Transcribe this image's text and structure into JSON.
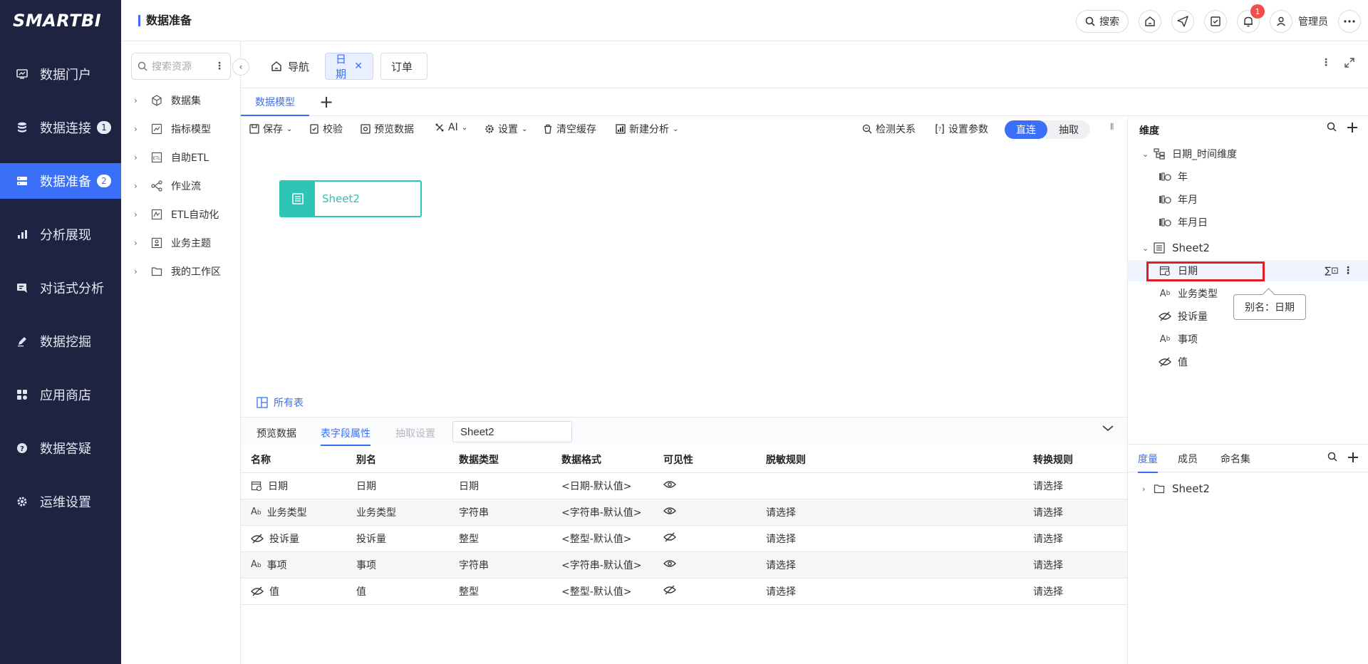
{
  "app": {
    "logo": "SMARTBI"
  },
  "leftnav": {
    "items": [
      {
        "label": "数据门户",
        "icon": "monitor-icon",
        "badge": ""
      },
      {
        "label": "数据连接",
        "icon": "database-icon",
        "badge": "1"
      },
      {
        "label": "数据准备",
        "icon": "server-icon",
        "badge": "2"
      },
      {
        "label": "分析展现",
        "icon": "bar-chart-icon",
        "badge": ""
      },
      {
        "label": "对话式分析",
        "icon": "chat-icon",
        "badge": ""
      },
      {
        "label": "数据挖掘",
        "icon": "pen-icon",
        "badge": ""
      },
      {
        "label": "应用商店",
        "icon": "apps-icon",
        "badge": ""
      },
      {
        "label": "数据答疑",
        "icon": "question-icon",
        "badge": ""
      },
      {
        "label": "运维设置",
        "icon": "gear-icon",
        "badge": ""
      }
    ],
    "active_index": 2
  },
  "header": {
    "title": "数据准备",
    "search_label": "搜索",
    "notification_count": "1",
    "user_label": "管理员"
  },
  "resources": {
    "search_placeholder": "搜索资源",
    "items": [
      {
        "label": "数据集",
        "icon": "cube-icon"
      },
      {
        "label": "指标模型",
        "icon": "metric-model-icon"
      },
      {
        "label": "自助ETL",
        "icon": "etl-icon"
      },
      {
        "label": "作业流",
        "icon": "workflow-icon"
      },
      {
        "label": "ETL自动化",
        "icon": "etl-auto-icon"
      },
      {
        "label": "业务主题",
        "icon": "business-topic-icon"
      },
      {
        "label": "我的工作区",
        "icon": "folder-icon"
      }
    ]
  },
  "tabs": {
    "nav_label": "导航",
    "items": [
      {
        "label": "日期",
        "active": true,
        "closable": true
      },
      {
        "label": "订单",
        "active": false,
        "closable": false
      }
    ]
  },
  "subtabs": {
    "model_label": "数据模型"
  },
  "toolbar": {
    "save": "保存",
    "verify": "校验",
    "preview": "预览数据",
    "ai": "AI",
    "settings": "设置",
    "clear_cache": "清空缓存",
    "new_analysis": "新建分析",
    "detect_relation": "检测关系",
    "set_params": "设置参数",
    "mode_direct": "直连",
    "mode_extract": "抽取"
  },
  "canvas": {
    "node_label": "Sheet2",
    "all_tables": "所有表"
  },
  "bottom": {
    "tab_preview": "预览数据",
    "tab_fields": "表字段属性",
    "tab_extract": "抽取设置",
    "table_select": "Sheet2",
    "columns": [
      "名称",
      "别名",
      "数据类型",
      "数据格式",
      "可见性",
      "脱敏规则",
      "转换规则"
    ],
    "rows": [
      {
        "icon": "date-icon",
        "name": "日期",
        "alias": "日期",
        "type": "日期",
        "format": "<日期-默认值>",
        "visible": true,
        "mask": "",
        "convert": "请选择"
      },
      {
        "icon": "text-type-icon",
        "name": "业务类型",
        "alias": "业务类型",
        "type": "字符串",
        "format": "<字符串-默认值>",
        "visible": true,
        "mask": "请选择",
        "convert": "请选择"
      },
      {
        "icon": "hidden-icon",
        "name": "投诉量",
        "alias": "投诉量",
        "type": "整型",
        "format": "<整型-默认值>",
        "visible": false,
        "mask": "请选择",
        "convert": "请选择"
      },
      {
        "icon": "text-type-icon",
        "name": "事项",
        "alias": "事项",
        "type": "字符串",
        "format": "<字符串-默认值>",
        "visible": true,
        "mask": "请选择",
        "convert": "请选择"
      },
      {
        "icon": "hidden-icon",
        "name": "值",
        "alias": "值",
        "type": "整型",
        "format": "<整型-默认值>",
        "visible": false,
        "mask": "请选择",
        "convert": "请选择"
      }
    ]
  },
  "dimension": {
    "title": "维度",
    "tree": [
      {
        "label": "日期_时间维度",
        "level": 0,
        "icon": "hierarchy-icon",
        "expanded": true
      },
      {
        "label": "年",
        "level": 1,
        "icon": "time-level-icon"
      },
      {
        "label": "年月",
        "level": 1,
        "icon": "time-level-icon"
      },
      {
        "label": "年月日",
        "level": 1,
        "icon": "time-level-icon"
      },
      {
        "label": "Sheet2",
        "level": 0,
        "icon": "table-icon",
        "expanded": true
      },
      {
        "label": "日期",
        "level": 1,
        "icon": "date-icon",
        "selected": true
      },
      {
        "label": "业务类型",
        "level": 1,
        "icon": "text-type-icon"
      },
      {
        "label": "投诉量",
        "level": 1,
        "icon": "hidden-icon"
      },
      {
        "label": "事项",
        "level": 1,
        "icon": "text-type-icon"
      },
      {
        "label": "值",
        "level": 1,
        "icon": "hidden-icon"
      }
    ],
    "tooltip": "别名：日期"
  },
  "measure": {
    "tabs": [
      "度量",
      "成员",
      "命名集"
    ],
    "active_tab": 0,
    "tree": [
      {
        "label": "Sheet2",
        "icon": "folder-icon"
      }
    ]
  },
  "colors": {
    "accent": "#3a6ff7",
    "nav_bg": "#1d2340",
    "node": "#2ec4b6",
    "highlight_box": "#e51c23",
    "badge_red": "#f14d4d"
  }
}
